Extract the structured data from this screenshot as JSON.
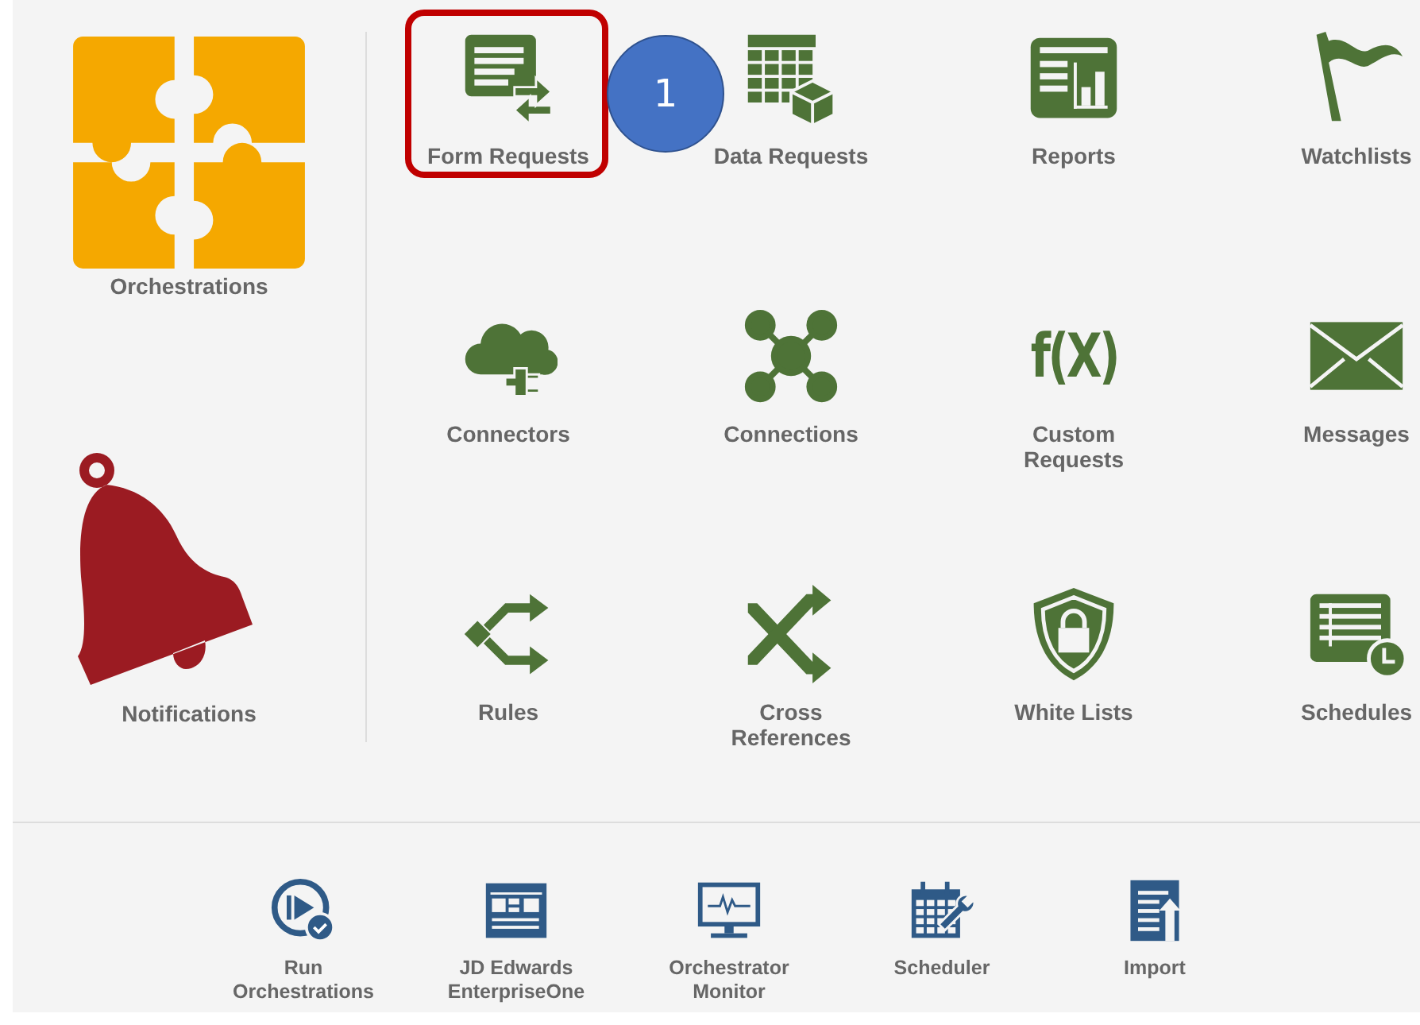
{
  "sidebar": [
    {
      "label": "Orchestrations"
    },
    {
      "label": "Notifications"
    }
  ],
  "tiles": [
    {
      "label": "Form Requests",
      "highlighted": true
    },
    {
      "label": "Data Requests",
      "highlighted": false
    },
    {
      "label": "Reports",
      "highlighted": false
    },
    {
      "label": "Watchlists",
      "highlighted": false
    },
    {
      "label": "Connectors",
      "highlighted": false
    },
    {
      "label": "Connections",
      "highlighted": false
    },
    {
      "label": "Custom\nRequests",
      "highlighted": false,
      "glyph": "f(X)"
    },
    {
      "label": "Messages",
      "highlighted": false
    },
    {
      "label": "Rules",
      "highlighted": false
    },
    {
      "label": "Cross\nReferences",
      "highlighted": false
    },
    {
      "label": "White Lists",
      "highlighted": false
    },
    {
      "label": "Schedules",
      "highlighted": false
    }
  ],
  "callout": {
    "number": "1"
  },
  "bottom_bar": [
    {
      "label": "Run\nOrchestrations"
    },
    {
      "label": "JD Edwards\nEnterpriseOne"
    },
    {
      "label": "Orchestrator\nMonitor"
    },
    {
      "label": "Scheduler"
    },
    {
      "label": "Import"
    }
  ]
}
